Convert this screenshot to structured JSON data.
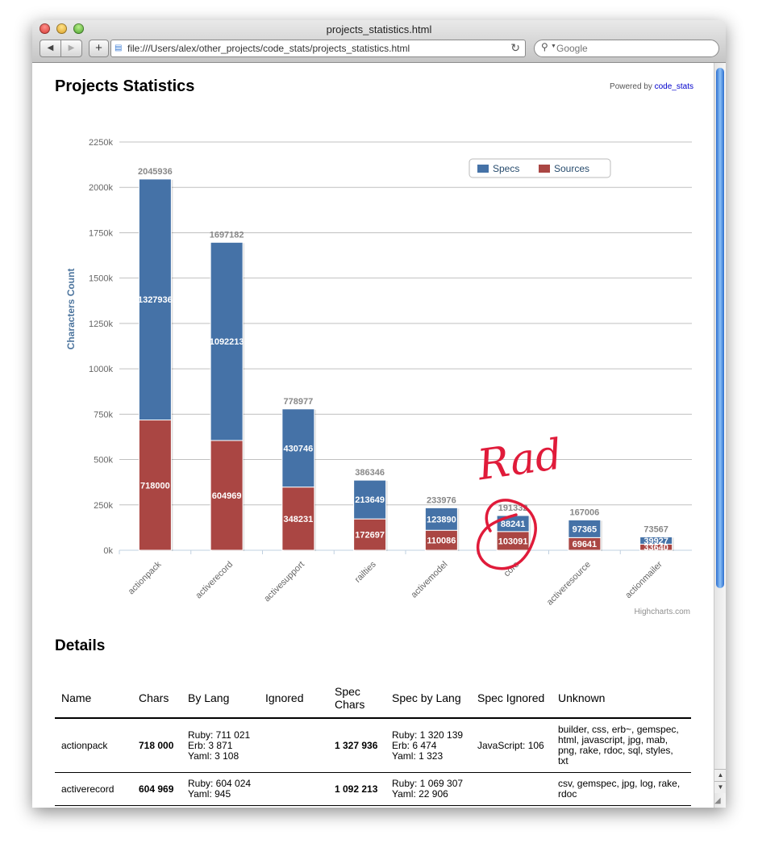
{
  "browser": {
    "window_title": "projects_statistics.html",
    "url": "file:///Users/alex/other_projects/code_stats/projects_statistics.html",
    "search_placeholder": "Google",
    "back_icon": "◀",
    "forward_icon": "▶",
    "add_icon": "+",
    "reload_icon": "↻"
  },
  "page": {
    "title": "Projects Statistics",
    "powered_prefix": "Powered by",
    "powered_link": "code_stats",
    "credits": "Highcharts.com",
    "annotation": "Rad"
  },
  "chart_data": {
    "type": "bar",
    "stacked": true,
    "ylabel": "Characters Count",
    "ylim": [
      0,
      2250000
    ],
    "yticks": [
      "0k",
      "250k",
      "500k",
      "750k",
      "1000k",
      "1250k",
      "1500k",
      "1750k",
      "2000k",
      "2250k"
    ],
    "grid": true,
    "legend_position": "top-right",
    "categories": [
      "actionpack",
      "activerecord",
      "activesupport",
      "railties",
      "activemodel",
      "core",
      "activeresource",
      "actionmailer"
    ],
    "series": [
      {
        "name": "Sources",
        "color": "#aa4643",
        "values": [
          718000,
          604969,
          348231,
          172697,
          110086,
          103091,
          69641,
          33640
        ]
      },
      {
        "name": "Specs",
        "color": "#4572a7",
        "values": [
          1327936,
          1092213,
          430746,
          213649,
          123890,
          88241,
          97365,
          39927
        ]
      }
    ],
    "totals": [
      2045936,
      1697182,
      778977,
      386346,
      233976,
      191332,
      167006,
      73567
    ]
  },
  "details": {
    "title": "Details",
    "headers": [
      "Name",
      "Chars",
      "By Lang",
      "Ignored",
      "Spec Chars",
      "Spec by Lang",
      "Spec Ignored",
      "Unknown"
    ],
    "rows": [
      {
        "name": "actionpack",
        "chars": "718 000",
        "by_lang": [
          "Ruby: 711 021",
          "Erb: 3 871",
          "Yaml: 3 108"
        ],
        "ignored": "",
        "spec_chars": "1 327 936",
        "spec_by_lang": [
          "Ruby: 1 320 139",
          "Erb: 6 474",
          "Yaml: 1 323"
        ],
        "spec_ignored": "JavaScript: 106",
        "unknown": "builder, css, erb~, gemspec, html, javascript, jpg, mab, png, rake, rdoc, sql, styles, txt"
      },
      {
        "name": "activerecord",
        "chars": "604 969",
        "by_lang": [
          "Ruby: 604 024",
          "Yaml: 945"
        ],
        "ignored": "",
        "spec_chars": "1 092 213",
        "spec_by_lang": [
          "Ruby: 1 069 307",
          "Yaml: 22 906"
        ],
        "spec_ignored": "",
        "unknown": "csv, gemspec, jpg, log, rake, rdoc"
      }
    ]
  }
}
